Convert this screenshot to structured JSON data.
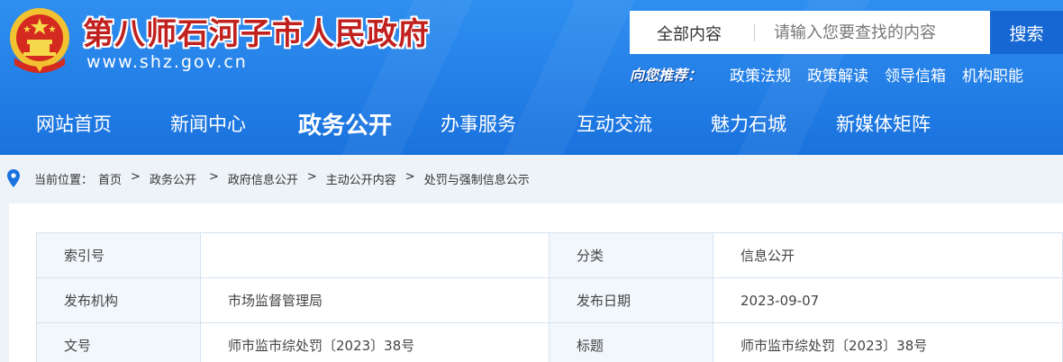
{
  "header": {
    "site_title": "第八师石河子市人民政府",
    "site_url": "www.shz.gov.cn",
    "emblem_icon": "national-emblem-icon",
    "colors": {
      "header_blue": "#1a72de",
      "title_red": "#c0211e",
      "search_blue": "#1667d3"
    }
  },
  "search": {
    "scope": "全部内容",
    "placeholder": "请输入您要查找的内容",
    "button": "搜索"
  },
  "recommend": {
    "label": "向您推荐：",
    "links": [
      "政策法规",
      "政策解读",
      "领导信箱",
      "机构职能"
    ]
  },
  "nav": {
    "items": [
      "网站首页",
      "新闻中心",
      "政务公开",
      "办事服务",
      "互动交流",
      "魅力石城",
      "新媒体矩阵"
    ],
    "active": "政务公开"
  },
  "breadcrumb": {
    "label": "当前位置：",
    "items": [
      "首页",
      "政务公开",
      "政府信息公开",
      "主动公开内容",
      "处罚与强制信息公示"
    ],
    "separator": ">"
  },
  "info_table": {
    "rows": [
      {
        "k1": "索引号",
        "v1": "",
        "k2": "分类",
        "v2": "信息公开"
      },
      {
        "k1": "发布机构",
        "v1": "市场监督管理局",
        "k2": "发布日期",
        "v2": "2023-09-07"
      },
      {
        "k1": "文号",
        "v1": "师市监市综处罚〔2023〕38号",
        "k2": "标题",
        "v2": "师市监市综处罚〔2023〕38号"
      }
    ]
  }
}
